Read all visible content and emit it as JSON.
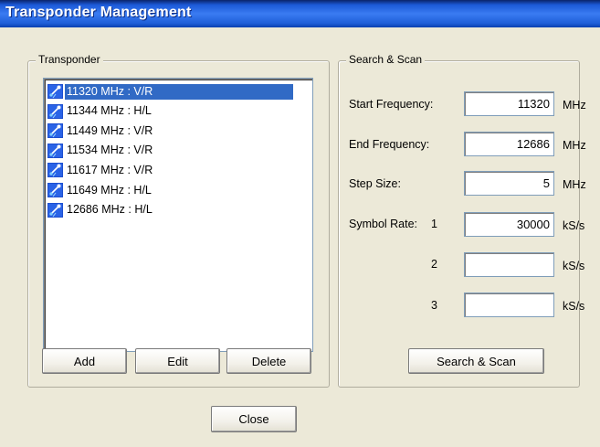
{
  "window": {
    "title": "Transponder Management"
  },
  "transponder": {
    "group_label": "Transponder",
    "items": [
      {
        "label": "11320 MHz : V/R",
        "selected": true
      },
      {
        "label": "11344 MHz : H/L",
        "selected": false
      },
      {
        "label": "11449 MHz : V/R",
        "selected": false
      },
      {
        "label": "11534 MHz : V/R",
        "selected": false
      },
      {
        "label": "11617 MHz : V/R",
        "selected": false
      },
      {
        "label": "11649 MHz : H/L",
        "selected": false
      },
      {
        "label": "12686 MHz : H/L",
        "selected": false
      }
    ],
    "add_label": "Add",
    "edit_label": "Edit",
    "delete_label": "Delete"
  },
  "scan": {
    "group_label": "Search & Scan",
    "start_label": "Start Frequency:",
    "start_value": "11320",
    "start_unit": "MHz",
    "end_label": "End Frequency:",
    "end_value": "12686",
    "end_unit": "MHz",
    "step_label": "Step Size:",
    "step_value": "5",
    "step_unit": "MHz",
    "symbol_label": "Symbol Rate:",
    "symbol1_index": "1",
    "symbol1_value": "30000",
    "symbol1_unit": "kS/s",
    "symbol2_index": "2",
    "symbol2_value": "",
    "symbol2_unit": "kS/s",
    "symbol3_index": "3",
    "symbol3_value": "",
    "symbol3_unit": "kS/s",
    "button_label": "Search & Scan"
  },
  "footer": {
    "close_label": "Close"
  },
  "colors": {
    "title_bar": "#1c5ad8",
    "selection": "#316ac5",
    "dialog_bg": "#ece9d8"
  },
  "icons": {
    "list_item": "satellite-dish-icon"
  }
}
